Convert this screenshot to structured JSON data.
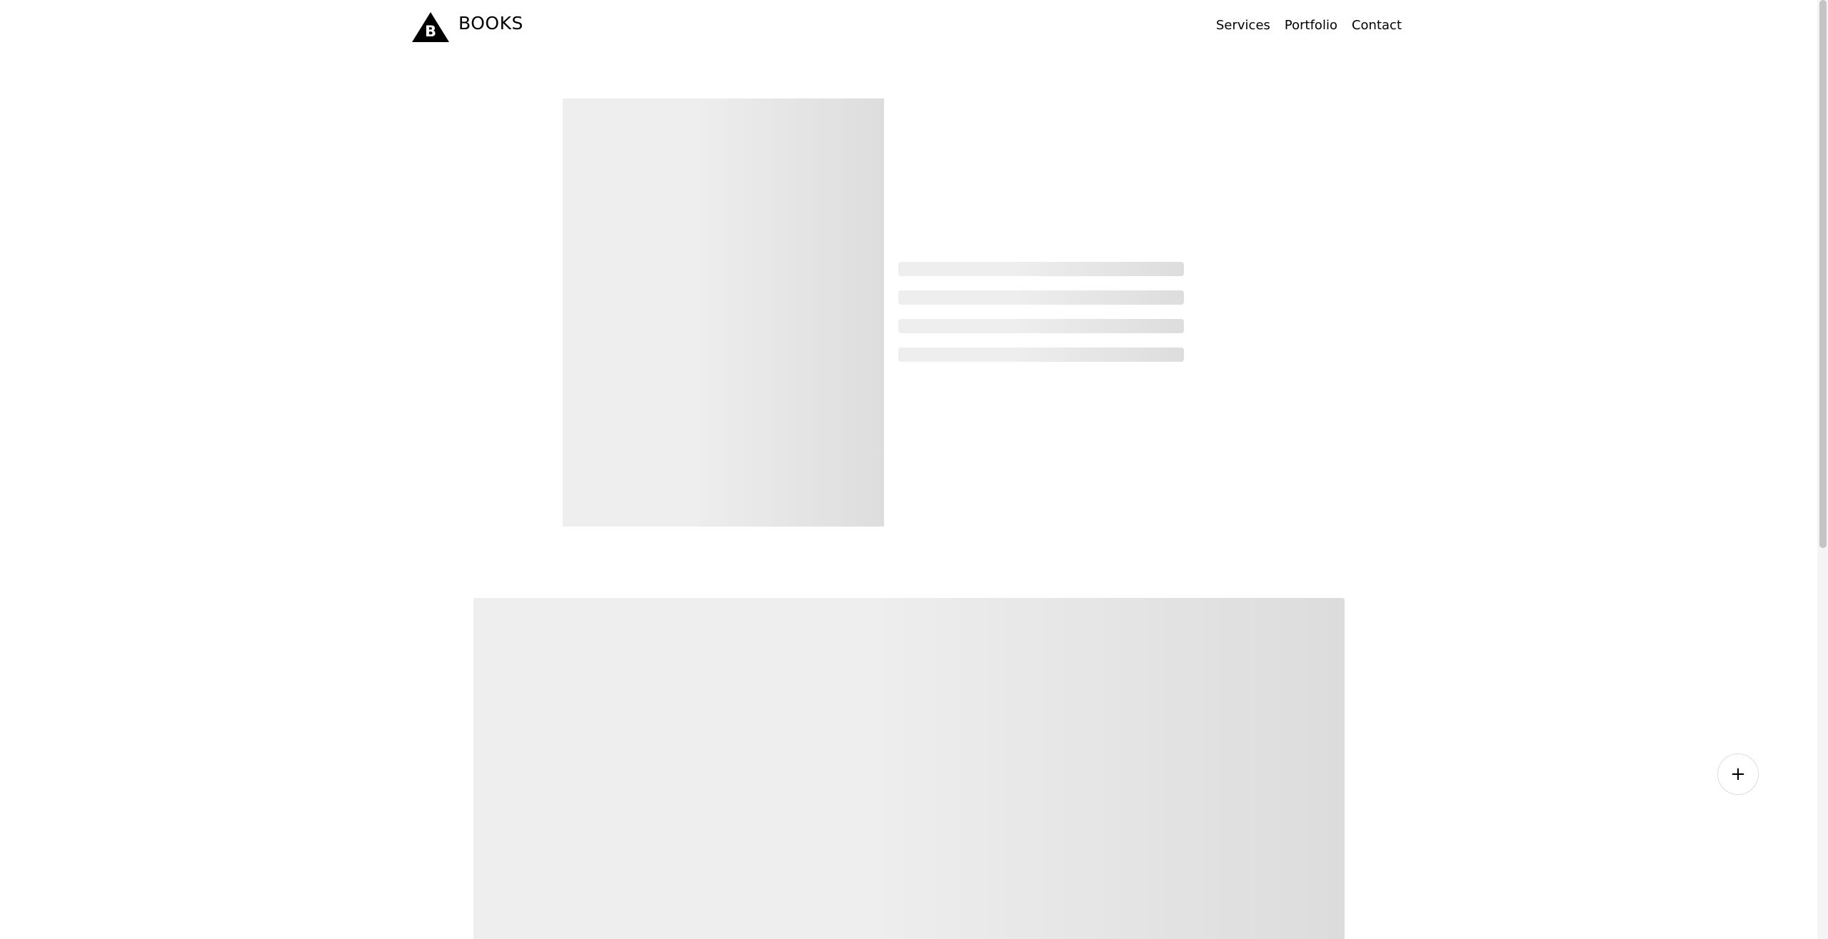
{
  "header": {
    "logo_letter": "B",
    "logo_text": "BOOKS",
    "nav": [
      {
        "label": "Services"
      },
      {
        "label": "Portfolio"
      },
      {
        "label": "Contact"
      }
    ]
  },
  "main": {
    "loading_text_lines": 4
  },
  "fab": {
    "icon": "plus-icon",
    "symbol": "+"
  },
  "colors": {
    "skeleton_light": "#eeeeee",
    "skeleton_dark": "#dddddd",
    "text": "#000000"
  }
}
